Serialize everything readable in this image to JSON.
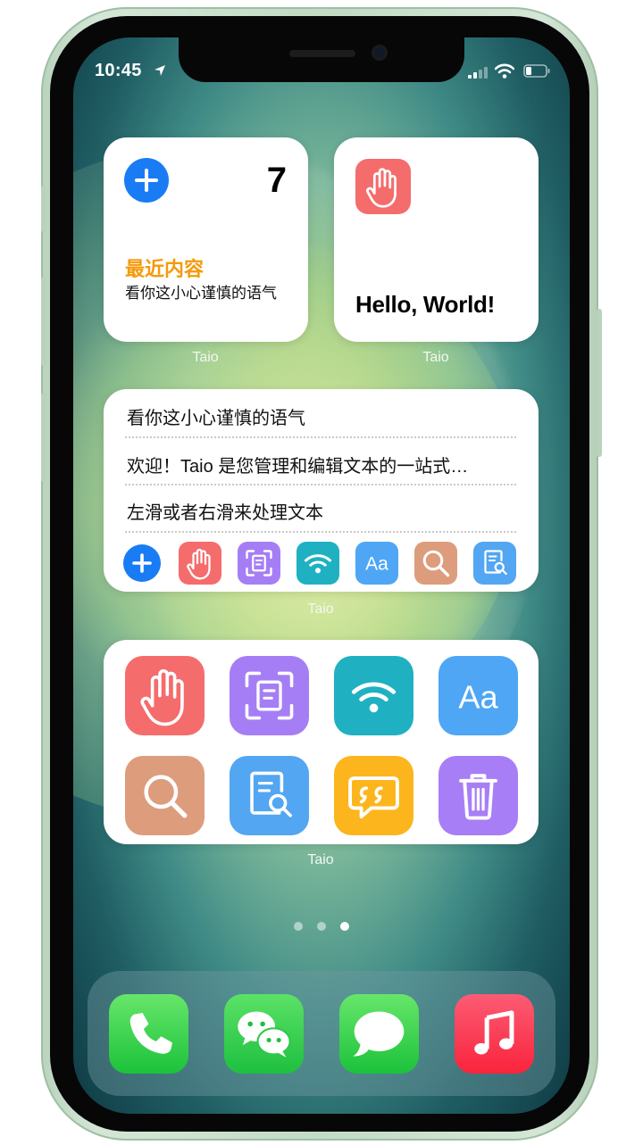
{
  "status_bar": {
    "time": "10:45"
  },
  "widgets": {
    "recent": {
      "count": "7",
      "title": "最近内容",
      "text": "看你这小心谨慎的语气",
      "caption": "Taio"
    },
    "hello": {
      "text": "Hello, World!",
      "caption": "Taio"
    },
    "list": {
      "rows": [
        "看你这小心谨慎的语气",
        "欢迎！Taio 是您管理和编辑文本的一站式…",
        "左滑或者右滑来处理文本"
      ],
      "caption": "Taio"
    },
    "actions": {
      "caption": "Taio"
    }
  },
  "icons": {
    "action_row": [
      "plus-icon",
      "hand-icon",
      "scan-text-icon",
      "wifi-icon",
      "font-aa-icon",
      "search-icon",
      "doc-search-icon"
    ],
    "action_grid": [
      "hand-icon",
      "scan-text-icon",
      "wifi-icon",
      "font-aa-icon",
      "search-icon",
      "doc-search-icon",
      "quote-bubble-icon",
      "trash-icon"
    ],
    "dock": [
      "phone-icon",
      "wechat-icon",
      "messages-icon",
      "music-icon"
    ],
    "font_label": "Aa"
  },
  "page_indicator": {
    "count": 3,
    "active_index": 2
  },
  "colors": {
    "accent_blue": "#1a7cf5",
    "orange_title": "#f59a0b",
    "red": "#f56c6c",
    "purple": "#a57ef5",
    "teal": "#1fb1c1",
    "blue": "#4ea6f5",
    "tan": "#dd9d7c",
    "yellow": "#fcb51d"
  }
}
